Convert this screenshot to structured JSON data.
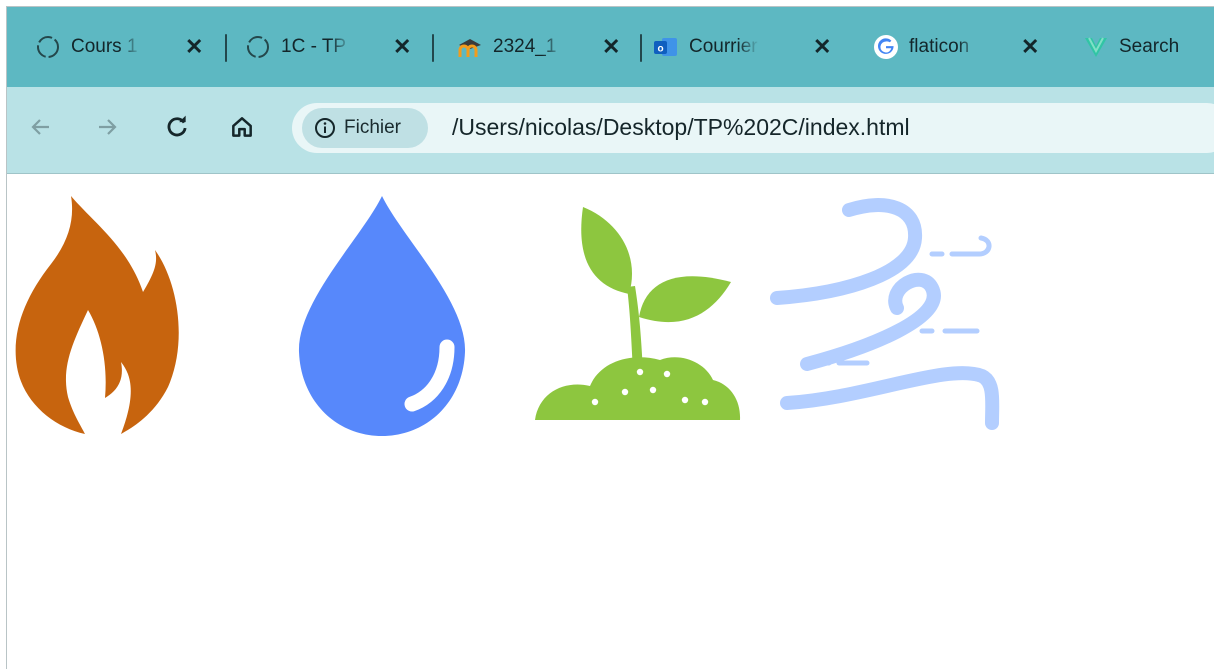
{
  "colors": {
    "tabstrip": "#5db8c2",
    "toolbar": "#b9e2e6",
    "fire": "#c7640e",
    "water": "#5788fb",
    "plant": "#8dc63f",
    "wind": "#b3ceff"
  },
  "tabs": [
    {
      "title": "Cours 1",
      "icon": "loading-circle-icon"
    },
    {
      "title": "1C - TP",
      "icon": "loading-circle-icon"
    },
    {
      "title": "2324_1",
      "icon": "moodle-icon"
    },
    {
      "title": "Courrier",
      "icon": "outlook-icon"
    },
    {
      "title": "flaticon",
      "icon": "google-icon"
    },
    {
      "title": "Search",
      "icon": "vuetify-icon"
    }
  ],
  "address_bar": {
    "chip_label": "Fichier",
    "url": "/Users/nicolas/Desktop/TP%202C/index.html"
  },
  "elements": [
    {
      "name": "fire",
      "icon": "fire-icon"
    },
    {
      "name": "water",
      "icon": "water-drop-icon"
    },
    {
      "name": "earth",
      "icon": "plant-sprout-icon"
    },
    {
      "name": "wind",
      "icon": "wind-icon"
    }
  ]
}
